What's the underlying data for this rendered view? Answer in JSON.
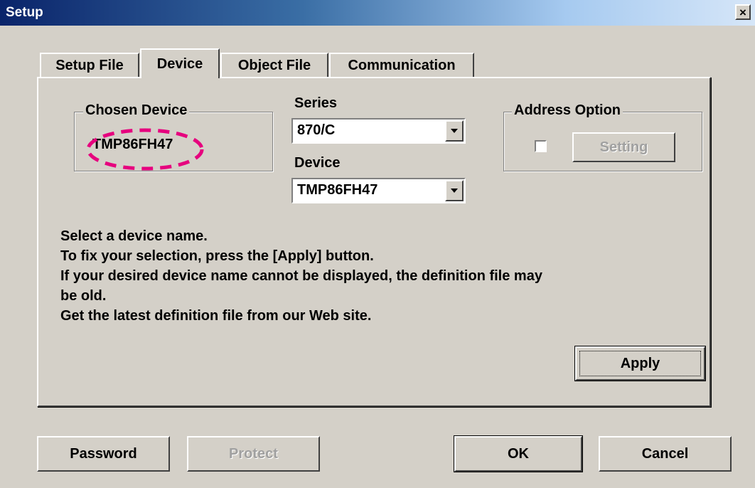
{
  "window": {
    "title": "Setup",
    "close_label": "×"
  },
  "tabs": [
    {
      "label": "Setup File"
    },
    {
      "label": "Device"
    },
    {
      "label": "Object File"
    },
    {
      "label": "Communication"
    }
  ],
  "device_tab": {
    "chosen_device": {
      "legend": "Chosen Device",
      "value": "TMP86FH47"
    },
    "series": {
      "label": "Series",
      "value": "870/C"
    },
    "device": {
      "label": "Device",
      "value": "TMP86FH47"
    },
    "address_option": {
      "legend": "Address Option",
      "checked": false,
      "setting_label": "Setting"
    },
    "instructions": [
      "Select a device name.",
      "To fix your selection, press the [Apply] button.",
      "If your desired device name cannot be displayed, the definition file may",
      "be old.",
      "Get the latest definition file from our Web site."
    ],
    "apply_label": "Apply"
  },
  "footer": {
    "password_label": "Password",
    "protect_label": "Protect",
    "ok_label": "OK",
    "cancel_label": "Cancel"
  },
  "colors": {
    "highlight": "#e6007e",
    "titlebar_start": "#0a246a",
    "face": "#d4d0c8"
  }
}
